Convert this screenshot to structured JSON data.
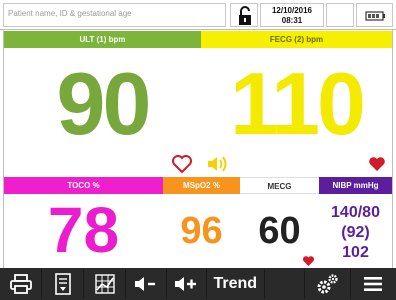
{
  "header": {
    "patient_placeholder": "Patient name, ID & gestational age",
    "date": "12/10/2016",
    "time": "08:31"
  },
  "channels": {
    "ult": {
      "label": "ULT (1) bpm",
      "value": "90",
      "color": "#78a83c"
    },
    "fecg": {
      "label": "FECG (2) bpm",
      "value": "110",
      "color": "#f3ea00"
    },
    "toco": {
      "label": "TOCO %",
      "value": "78",
      "color": "#ec1dce"
    },
    "mspo2": {
      "label": "MSpO2 %",
      "value": "96",
      "color": "#f7941d"
    },
    "mecg": {
      "label": "MECG",
      "value": "60"
    },
    "nibp": {
      "label": "NIBP mmHg",
      "systolic_diastolic": "140/80",
      "mean": "(92)",
      "pulse": "102",
      "color": "#5b1f9e"
    }
  },
  "toolbar": {
    "trend_label": "Trend",
    "icons": [
      "print-icon",
      "record-icon",
      "grid-icon",
      "volume-down-icon",
      "volume-up-icon",
      "settings-icon",
      "menu-icon"
    ]
  }
}
